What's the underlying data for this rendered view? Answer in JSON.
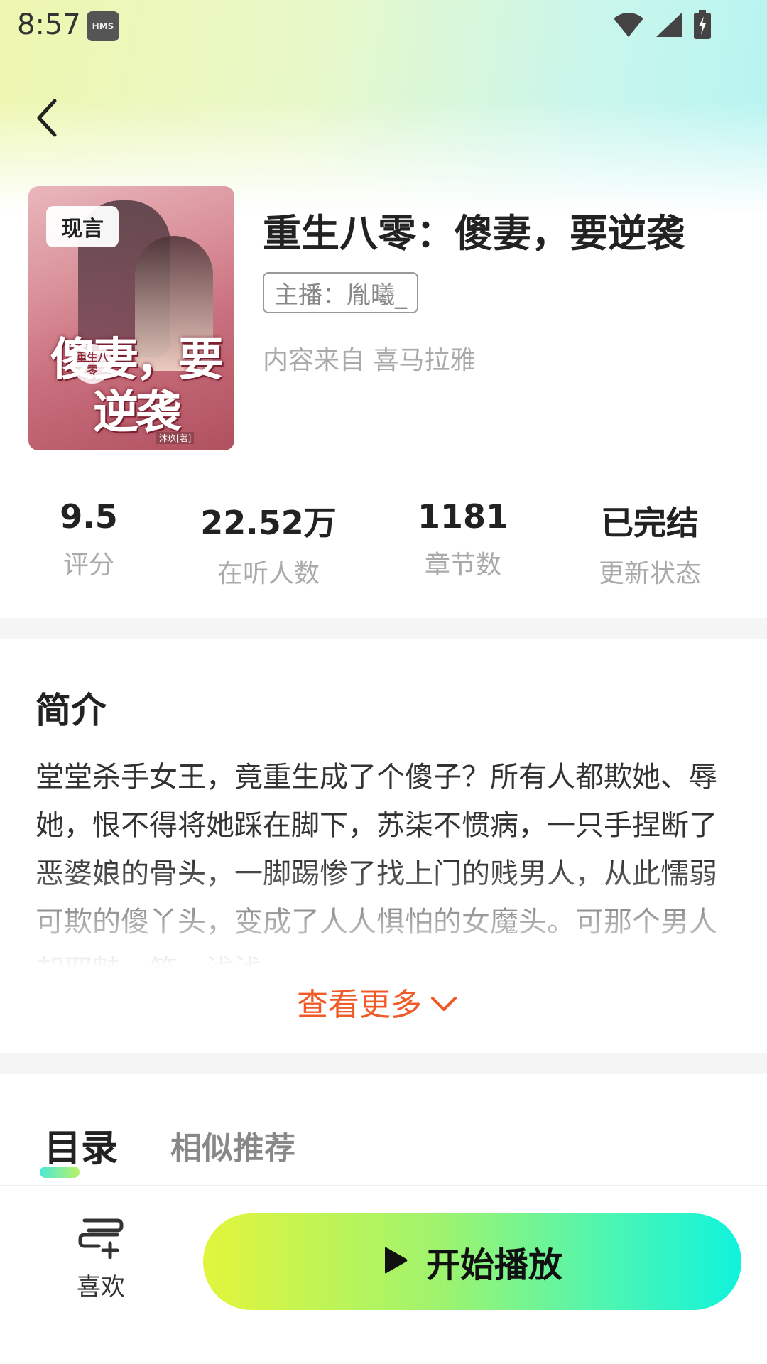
{
  "status_bar": {
    "time": "8:57",
    "badge": "HMS",
    "icons": [
      "wifi-icon",
      "signal-icon",
      "battery-charging-icon"
    ]
  },
  "nav": {
    "back_icon": "chevron-left-icon"
  },
  "book": {
    "genre_tag": "现言",
    "title": "重生八零：傻妻，要逆袭",
    "narrator": "主播：胤曦_",
    "source": "内容来自 喜马拉雅",
    "cover": {
      "title_art": "傻妻，要逆袭",
      "series_mark": "重生八零",
      "author_mark": "沐玖[著]"
    }
  },
  "stats": [
    {
      "value": "9.5",
      "label": "评分"
    },
    {
      "value": "22.52万",
      "label": "在听人数"
    },
    {
      "value": "1181",
      "label": "章节数"
    },
    {
      "value": "已完结",
      "label": "更新状态"
    }
  ],
  "intro": {
    "heading": "简介",
    "text": "堂堂杀手女王，竟重生成了个傻子？所有人都欺她、辱她，恨不得将她踩在脚下，苏柒不惯病，一只手捏断了恶婆娘的骨头，一脚踢惨了找上门的贱男人，从此懦弱可欺的傻丫头，变成了人人惧怕的女魔头。可那个男人却邪魅一笑，浅浅",
    "see_more": "查看更多"
  },
  "tabs": {
    "active": "目录",
    "inactive": "相似推荐"
  },
  "bottom_bar": {
    "like_label": "喜欢",
    "play_label": "开始播放"
  },
  "colors": {
    "accent_orange": "#f05a28",
    "play_gradient_start": "#e2f53c",
    "play_gradient_end": "#10f3dc"
  }
}
